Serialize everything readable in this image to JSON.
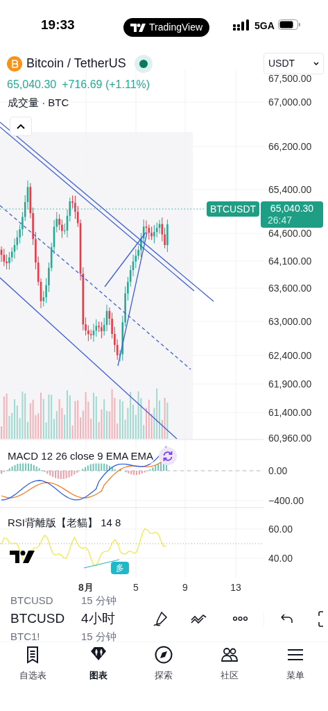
{
  "status_bar": {
    "time": "19:33",
    "app_pill": "TradingView",
    "network": "5GA"
  },
  "symbol": {
    "name": "Bitcoin / TetherUS",
    "price": "65,040.30",
    "change": "+716.69 (+1.11%)",
    "currency": "USDT",
    "volume_label": "成交量 · BTC"
  },
  "price_axis": [
    "67,500.00",
    "67,000.00",
    "66,200.00",
    "65,400.00",
    "64,600.00",
    "64,100.00",
    "63,600.00",
    "63,000.00",
    "62,400.00",
    "61,900.00",
    "61,400.00",
    "60,960.00"
  ],
  "last_price_tag": {
    "symbol": "BTCUSDT",
    "price": "65,040.30",
    "countdown": "26:47"
  },
  "macd": {
    "label": "MACD 12 26 close 9 EMA EMA",
    "axis": [
      "0.00",
      "−400.00"
    ]
  },
  "rsi": {
    "label": "RSI背離版【老貓】 14 8",
    "axis": [
      "60.00",
      "40.00"
    ],
    "signal": "多"
  },
  "time_axis": [
    {
      "label": "8月",
      "major": true
    },
    {
      "label": "5",
      "major": false
    },
    {
      "label": "9",
      "major": false
    },
    {
      "label": "13",
      "major": false
    }
  ],
  "symbol_picker": [
    {
      "symbol": "BTCUSD",
      "interval": "15 分钟",
      "selected": false
    },
    {
      "symbol": "BTCUSD",
      "interval": "4小时",
      "selected": true
    },
    {
      "symbol": "BTC1!",
      "interval": "15 分钟",
      "selected": false
    }
  ],
  "tab_bar": [
    {
      "label": "自选表",
      "selected": false
    },
    {
      "label": "图表",
      "selected": true
    },
    {
      "label": "探索",
      "selected": false
    },
    {
      "label": "社区",
      "selected": false
    },
    {
      "label": "菜单",
      "selected": false
    }
  ]
}
